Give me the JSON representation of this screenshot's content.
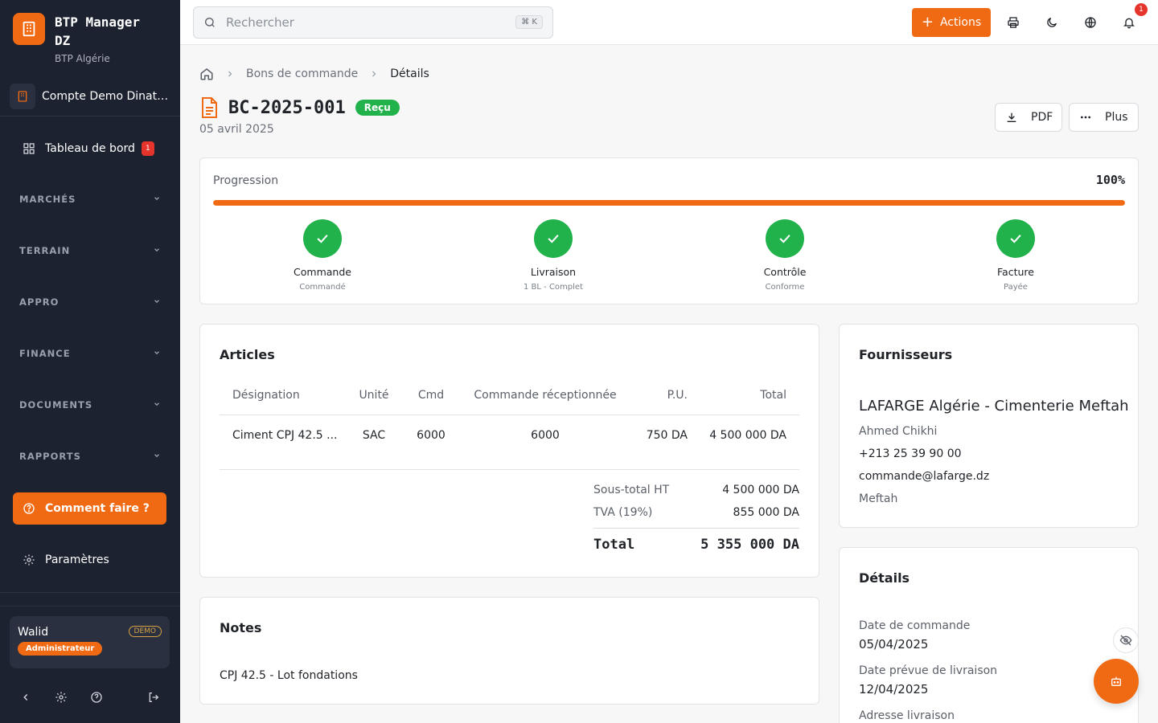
{
  "brand": {
    "title": "BTP Manager DZ",
    "subtitle": "BTP Algérie"
  },
  "account": {
    "label": "Compte Demo Dinatec"
  },
  "sidebar": {
    "dashboard": {
      "label": "Tableau de bord",
      "badge": "1"
    },
    "sections": [
      "MARCHÉS",
      "TERRAIN",
      "APPRO",
      "FINANCE",
      "DOCUMENTS",
      "RAPPORTS"
    ],
    "help_label": "Comment faire ?",
    "settings_label": "Paramètres",
    "user": {
      "name": "Walid",
      "demo": "DEMO",
      "role": "Administrateur"
    }
  },
  "topbar": {
    "search_placeholder": "Rechercher",
    "shortcut": "⌘ K",
    "actions_label": "Actions",
    "notif_count": "1"
  },
  "breadcrumb": {
    "items": [
      "Bons de commande",
      "Détails"
    ]
  },
  "page": {
    "doc_number": "BC-2025-001",
    "status": "Reçu",
    "date": "05 avril 2025",
    "pdf_label": "PDF",
    "more_label": "Plus"
  },
  "progress": {
    "label": "Progression",
    "percent_text": "100%",
    "value": 1.0,
    "steps": [
      {
        "title": "Commande",
        "sub": "Commandé"
      },
      {
        "title": "Livraison",
        "sub": "1 BL - Complet"
      },
      {
        "title": "Contrôle",
        "sub": "Conforme"
      },
      {
        "title": "Facture",
        "sub": "Payée"
      }
    ]
  },
  "articles": {
    "title": "Articles",
    "headers": [
      "Désignation",
      "Unité",
      "Cmd",
      "Commande réceptionnée",
      "P.U.",
      "Total"
    ],
    "rows": [
      {
        "designation": "Ciment CPJ 42.5 ...",
        "unit": "SAC",
        "cmd": "6000",
        "received": "6000",
        "pu": "750 DA",
        "total": "4 500 000 DA"
      }
    ],
    "subtotal_label": "Sous-total HT",
    "subtotal_value": "4 500 000 DA",
    "tva_label": "TVA (19%)",
    "tva_value": "855 000 DA",
    "total_label": "Total",
    "total_value": "5 355 000 DA"
  },
  "notes": {
    "title": "Notes",
    "text": "CPJ 42.5 - Lot fondations"
  },
  "supplier": {
    "title": "Fournisseurs",
    "name": "LAFARGE Algérie - Cimenterie Meftah",
    "contact": "Ahmed Chikhi",
    "phone": "+213 25 39 90 00",
    "email": "commande@lafarge.dz",
    "city": "Meftah"
  },
  "details": {
    "title": "Détails",
    "order_date_label": "Date de commande",
    "order_date": "05/04/2025",
    "delivery_date_label": "Date prévue de livraison",
    "delivery_date": "12/04/2025",
    "address_label": "Adresse livraison"
  },
  "colors": {
    "accent": "#f06a14",
    "success": "#22b24c",
    "sidebar": "#1c2230",
    "danger": "#e5342b"
  }
}
